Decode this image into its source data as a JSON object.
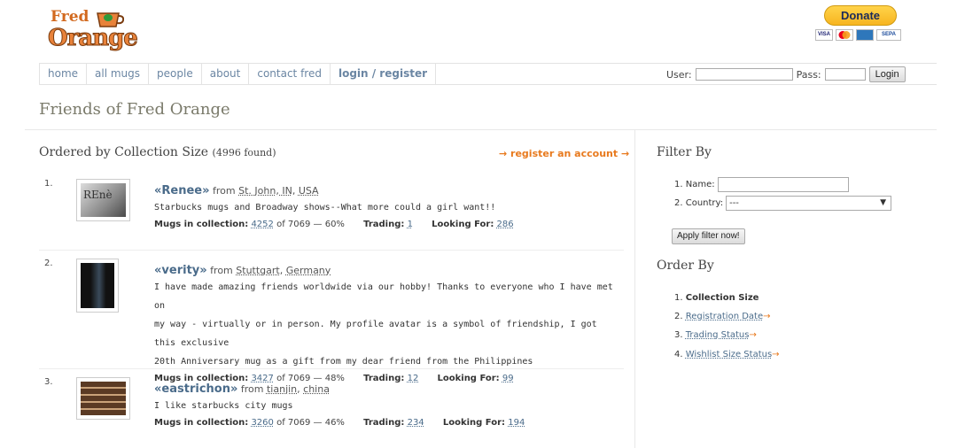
{
  "header": {
    "logo_word1": "Fred",
    "logo_word2": "Orange",
    "donate_label": "Donate",
    "cards": [
      "VISA",
      "MC",
      "AMEX",
      "SEPA"
    ]
  },
  "nav": {
    "items": [
      "home",
      "all mugs",
      "people",
      "about",
      "contact fred",
      "login / register"
    ]
  },
  "login": {
    "user_label": "User:",
    "pass_label": "Pass:",
    "button_label": "Login"
  },
  "page": {
    "title": "Friends of Fred Orange"
  },
  "list": {
    "heading": "Ordered by Collection Size",
    "found": "(4996 found)",
    "register_link": "→ register an account →",
    "entries": [
      {
        "num": "1.",
        "name": "Renee",
        "from_label": "from",
        "city": "St. John, IN",
        "country": "USA",
        "desc": [
          "Starbucks mugs and Broadway shows--What more could a girl want!!"
        ],
        "collection_label": "Mugs in collection:",
        "collection": "4252",
        "total": "of 7069 — 60%",
        "trading_label": "Trading:",
        "trading": "1",
        "looking_label": "Looking For:",
        "looking": "286"
      },
      {
        "num": "2.",
        "name": "verity",
        "from_label": "from",
        "city": "Stuttgart",
        "country": "Germany",
        "desc": [
          "I have made amazing friends worldwide via our hobby! Thanks to everyone who I have met on",
          "my way - virtually or in person. My profile avatar is a symbol of friendship, I got this exclusive",
          "20th Anniversary mug as a gift from my dear friend from the Philippines"
        ],
        "collection_label": "Mugs in collection:",
        "collection": "3427",
        "total": "of 7069 — 48%",
        "trading_label": "Trading:",
        "trading": "12",
        "looking_label": "Looking For:",
        "looking": "99"
      },
      {
        "num": "3.",
        "name": "eastrichon",
        "from_label": "from",
        "city": "tianjin",
        "country": "china",
        "desc": [
          "I like starbucks city mugs"
        ],
        "collection_label": "Mugs in collection:",
        "collection": "3260",
        "total": "of 7069 — 46%",
        "trading_label": "Trading:",
        "trading": "234",
        "looking_label": "Looking For:",
        "looking": "194"
      }
    ]
  },
  "sidebar": {
    "filter_heading": "Filter By",
    "filter_name_label": "1. Name:",
    "filter_country_label": "2. Country:",
    "filter_country_value": "---",
    "apply_label": "Apply filter now!",
    "order_heading": "Order By",
    "order_items": [
      {
        "num": "1.",
        "label": "Collection Size"
      },
      {
        "num": "2.",
        "label": "Registration Date"
      },
      {
        "num": "3.",
        "label": "Trading Status"
      },
      {
        "num": "4.",
        "label": "Wishlist Size Status"
      }
    ],
    "order_arrow": "→"
  },
  "colors": {
    "accent_orange": "#e87a1e",
    "link_blue": "#4a6b8a",
    "donate_yellow": "#ffc439"
  }
}
